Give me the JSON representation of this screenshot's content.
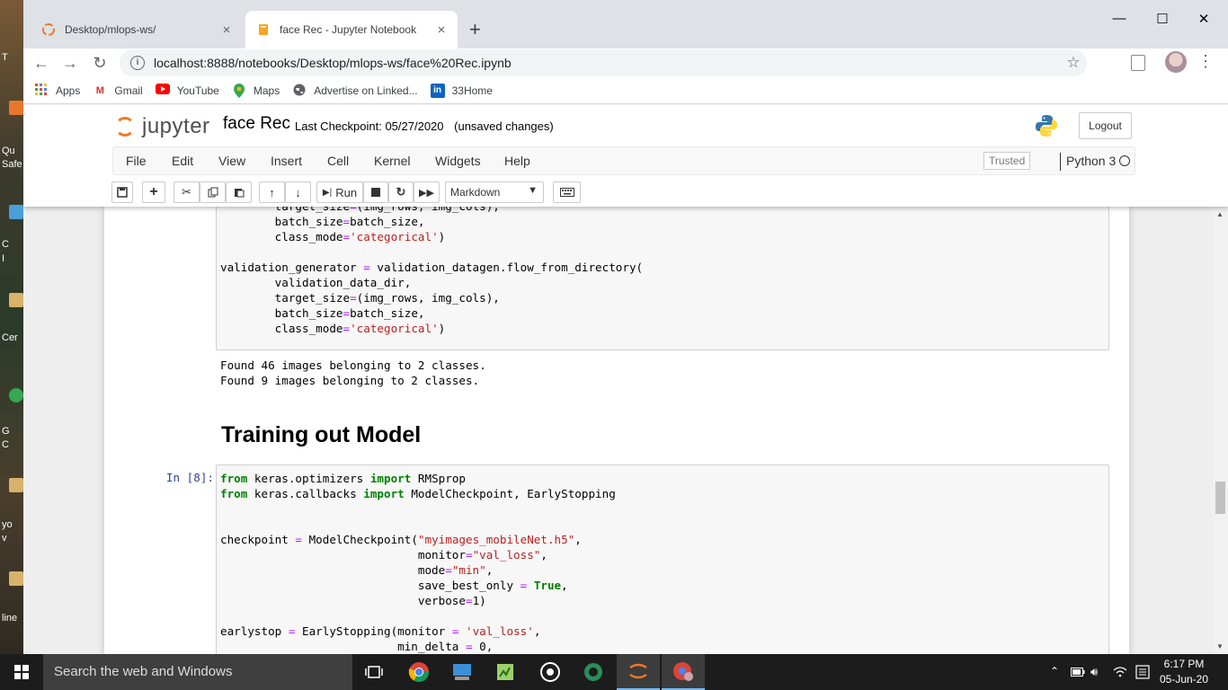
{
  "desktop": {
    "labels": [
      "T",
      "Qu",
      "Safe",
      "C",
      "I",
      "Cer",
      "G",
      "C",
      "yo",
      "v",
      "line"
    ]
  },
  "browser": {
    "tabs": [
      {
        "title": "Desktop/mlops-ws/",
        "close": "×"
      },
      {
        "title": "face Rec - Jupyter Notebook",
        "close": "×"
      }
    ],
    "new_tab": "+",
    "window_controls": {
      "minimize": "—",
      "maximize": "☐",
      "close": "✕"
    },
    "url": "localhost:8888/notebooks/Desktop/mlops-ws/face%20Rec.ipynb",
    "bookmarks": [
      {
        "label": "Apps",
        "icon": "apps-grid-icon",
        "color": "#ea4335"
      },
      {
        "label": "Gmail",
        "icon": "gmail-icon",
        "color": "#d93025"
      },
      {
        "label": "YouTube",
        "icon": "youtube-icon",
        "color": "#ff0000"
      },
      {
        "label": "Maps",
        "icon": "maps-pin-icon",
        "color": "#34a853"
      },
      {
        "label": "Advertise on Linked...",
        "icon": "globe-icon",
        "color": "#5f6368"
      },
      {
        "label": "33Home",
        "icon": "linkedin-icon",
        "color": "#0a66c2"
      }
    ]
  },
  "jupyter": {
    "logo_text": "jupyter",
    "notebook_name": "face Rec",
    "checkpoint_label": "Last Checkpoint: 05/27/2020",
    "unsaved": "(unsaved changes)",
    "logout": "Logout",
    "menu": [
      "File",
      "Edit",
      "View",
      "Insert",
      "Cell",
      "Kernel",
      "Widgets",
      "Help"
    ],
    "trusted": "Trusted",
    "kernel": "Python 3",
    "run_label": "Run",
    "cell_type": "Markdown",
    "accent": "#f37726"
  },
  "notebook": {
    "heading": "Training out Model",
    "prompt_8": "In [8]:",
    "output_lines": [
      "Found 46 images belonging to 2 classes.",
      "Found 9 images belonging to 2 classes."
    ]
  },
  "taskbar": {
    "search_placeholder": "Search the web and Windows",
    "time": "6:17 PM",
    "date": "05-Jun-20"
  }
}
